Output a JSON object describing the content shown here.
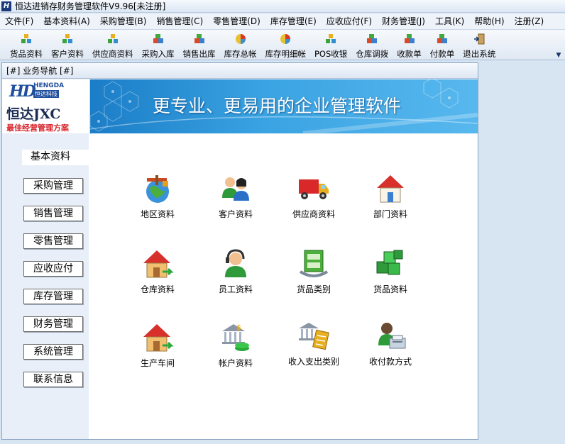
{
  "window": {
    "title": "恒达进销存财务管理软件V9.96[未注册]",
    "logo_letter": "H"
  },
  "menu": [
    "文件(F)",
    "基本资料(A)",
    "采购管理(B)",
    "销售管理(C)",
    "零售管理(D)",
    "库存管理(E)",
    "应收应付(F)",
    "财务管理(J)",
    "工具(K)",
    "帮助(H)",
    "注册(Z)"
  ],
  "toolbar": [
    {
      "label": "货品资料",
      "icon": "cubes-icon"
    },
    {
      "label": "客户资料",
      "icon": "cubes-icon"
    },
    {
      "label": "供应商资料",
      "icon": "cubes-icon"
    },
    {
      "label": "采购入库",
      "icon": "boxes-icon"
    },
    {
      "label": "销售出库",
      "icon": "boxes-icon"
    },
    {
      "label": "库存总帐",
      "icon": "pie-chart-icon"
    },
    {
      "label": "库存明细帐",
      "icon": "pie-chart-icon"
    },
    {
      "label": "POS收银",
      "icon": "cubes-icon"
    },
    {
      "label": "仓库调拨",
      "icon": "boxes-icon"
    },
    {
      "label": "收款单",
      "icon": "boxes-icon"
    },
    {
      "label": "付款单",
      "icon": "boxes-icon"
    },
    {
      "label": "退出系统",
      "icon": "exit-door-icon"
    }
  ],
  "nav_window": {
    "title": "[#] 业务导航 [#]"
  },
  "banner": {
    "brand_en": "HENGDA",
    "brand_cn_small": "恒达科技",
    "brand_hd": "HD",
    "brand_name": "恒达JXC",
    "slogan": "最佳经营管理方案",
    "headline": "更专业、更易用的企业管理软件",
    "colors": {
      "sky": "#2a90d6",
      "slogan_red": "#d8252d",
      "brand_blue": "#1f4e9c"
    }
  },
  "sidebar": [
    {
      "label": "基本资料",
      "active": true
    },
    {
      "label": "采购管理"
    },
    {
      "label": "销售管理"
    },
    {
      "label": "零售管理"
    },
    {
      "label": "应收应付"
    },
    {
      "label": "库存管理"
    },
    {
      "label": "财务管理"
    },
    {
      "label": "系统管理"
    },
    {
      "label": "联系信息"
    }
  ],
  "functions": [
    {
      "label": "地区资料",
      "icon": "globe-icon"
    },
    {
      "label": "客户资料",
      "icon": "customers-icon"
    },
    {
      "label": "供应商资料",
      "icon": "truck-icon"
    },
    {
      "label": "部门资料",
      "icon": "house-icon"
    },
    {
      "label": "仓库资料",
      "icon": "warehouse-icon"
    },
    {
      "label": "员工资料",
      "icon": "headset-operator-icon"
    },
    {
      "label": "货品类别",
      "icon": "cabinet-icon"
    },
    {
      "label": "货品资料",
      "icon": "green-cubes-icon"
    },
    {
      "label": "生产车间",
      "icon": "workshop-house-icon"
    },
    {
      "label": "帐户资料",
      "icon": "bank-coins-icon"
    },
    {
      "label": "收入支出类别",
      "icon": "bank-clipboard-icon"
    },
    {
      "label": "收付款方式",
      "icon": "cashier-icon"
    }
  ]
}
